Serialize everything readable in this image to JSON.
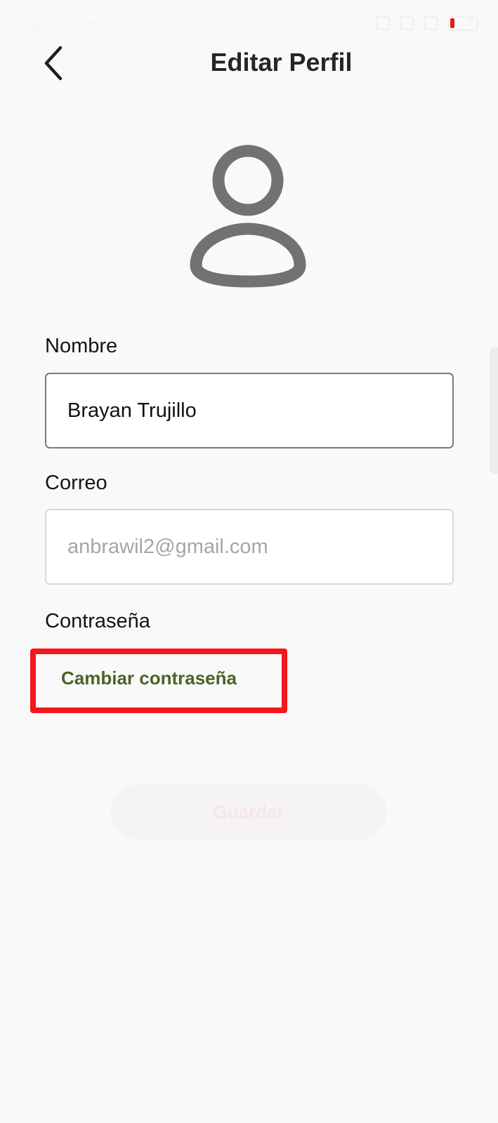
{
  "status_bar": {
    "time": "10:05 a. m.",
    "battery": "2"
  },
  "header": {
    "title": "Editar Perfil",
    "back_icon": "chevron-left-icon"
  },
  "avatar": {
    "icon": "user-icon",
    "color": "#707274"
  },
  "form": {
    "name_label": "Nombre",
    "name_value": "Brayan Trujillo",
    "email_label": "Correo",
    "email_placeholder": "anbrawil2@gmail.com",
    "password_label": "Contraseña",
    "change_password_label": "Cambiar contraseña",
    "save_label": "Guardar"
  },
  "colors": {
    "link": "#4c6226",
    "highlight": "#f4151d",
    "background": "#f9f9f9"
  }
}
